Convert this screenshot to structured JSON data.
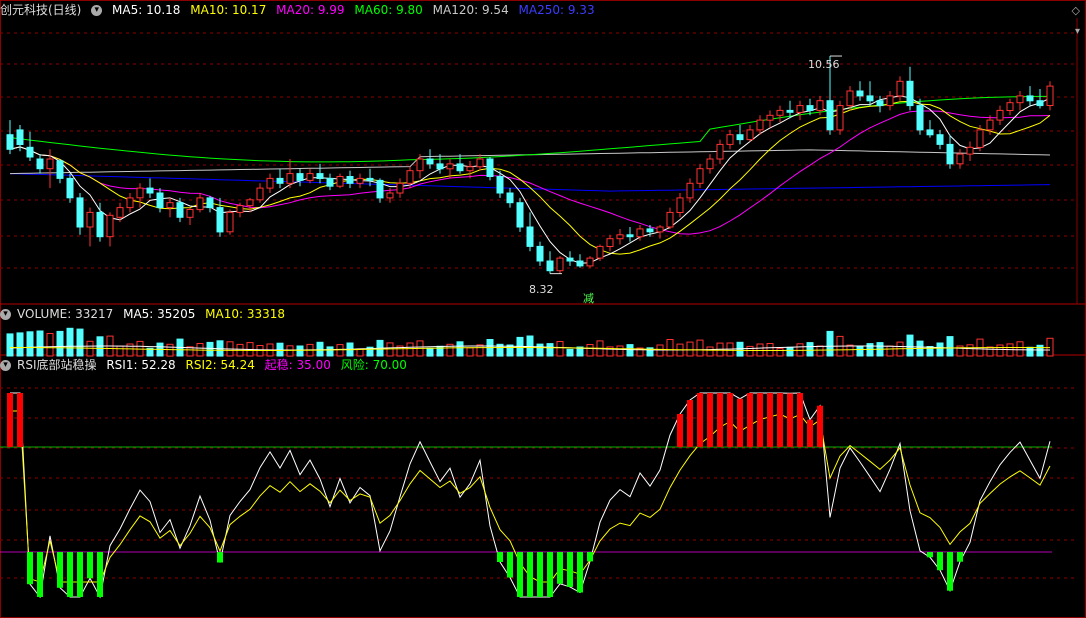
{
  "main_header": {
    "stock": "创元科技(日线)",
    "ma5": "MA5: 10.18",
    "ma10": "MA10: 10.17",
    "ma20": "MA20: 9.99",
    "ma60": "MA60: 9.80",
    "ma120": "MA120: 9.54",
    "ma250": "MA250: 9.33"
  },
  "volume_header": {
    "title": "VOLUME: 33217",
    "ma5": "MA5: 35205",
    "ma10": "MA10: 33318"
  },
  "rsi_header": {
    "title": "RSI底部站稳操",
    "rsi1": "RSI1: 52.28",
    "rsi2": "RSI2: 54.24",
    "qiwen": "起稳: 35.00",
    "fengxian": "风险: 70.00"
  },
  "annotations": {
    "high_label": "10.56",
    "low_label": "8.32",
    "jian_label": "减"
  },
  "colors": {
    "up": "#ff3232",
    "down": "#54ffff",
    "ma5": "#ffffff",
    "ma10": "#ffff00",
    "ma20": "#ff00ff",
    "ma60": "#00ff00",
    "ma120": "#c8c8c8",
    "ma250": "#0000ff",
    "grid": "#8b0000",
    "rsi_green_line": "#00b400",
    "rsi_magenta_line": "#b400b4"
  },
  "chart_data": [
    {
      "type": "candlestick",
      "title": "创元科技(日线)",
      "ylim": [
        8.1,
        10.9
      ],
      "annotated_high": 10.56,
      "annotated_low": 8.32,
      "ohlc": [
        [
          9.75,
          9.9,
          9.55,
          9.6
        ],
        [
          9.8,
          9.85,
          9.58,
          9.65
        ],
        [
          9.62,
          9.78,
          9.48,
          9.52
        ],
        [
          9.5,
          9.55,
          9.35,
          9.4
        ],
        [
          9.4,
          9.6,
          9.2,
          9.5
        ],
        [
          9.48,
          9.5,
          9.25,
          9.3
        ],
        [
          9.3,
          9.35,
          9.05,
          9.1
        ],
        [
          9.1,
          9.15,
          8.72,
          8.8
        ],
        [
          8.8,
          9.0,
          8.6,
          8.95
        ],
        [
          8.95,
          9.05,
          8.65,
          8.7
        ],
        [
          8.7,
          8.95,
          8.6,
          8.92
        ],
        [
          8.9,
          9.05,
          8.85,
          9.0
        ],
        [
          9.0,
          9.15,
          8.95,
          9.1
        ],
        [
          9.1,
          9.25,
          9.0,
          9.2
        ],
        [
          9.2,
          9.3,
          9.1,
          9.15
        ],
        [
          9.15,
          9.2,
          8.95,
          9.0
        ],
        [
          9.0,
          9.1,
          8.9,
          9.05
        ],
        [
          9.05,
          9.1,
          8.85,
          8.9
        ],
        [
          8.9,
          9.0,
          8.82,
          8.98
        ],
        [
          8.98,
          9.15,
          8.95,
          9.1
        ],
        [
          9.1,
          9.12,
          8.95,
          9.0
        ],
        [
          9.0,
          9.1,
          8.7,
          8.75
        ],
        [
          8.75,
          8.98,
          8.72,
          8.95
        ],
        [
          8.95,
          9.05,
          8.9,
          9.02
        ],
        [
          9.02,
          9.1,
          8.95,
          9.08
        ],
        [
          9.08,
          9.25,
          9.05,
          9.2
        ],
        [
          9.2,
          9.35,
          9.15,
          9.3
        ],
        [
          9.3,
          9.4,
          9.2,
          9.25
        ],
        [
          9.25,
          9.5,
          9.2,
          9.35
        ],
        [
          9.35,
          9.4,
          9.22,
          9.28
        ],
        [
          9.28,
          9.4,
          9.25,
          9.35
        ],
        [
          9.35,
          9.45,
          9.25,
          9.3
        ],
        [
          9.3,
          9.35,
          9.18,
          9.22
        ],
        [
          9.22,
          9.35,
          9.2,
          9.32
        ],
        [
          9.32,
          9.38,
          9.2,
          9.25
        ],
        [
          9.25,
          9.35,
          9.2,
          9.3
        ],
        [
          9.3,
          9.4,
          9.22,
          9.28
        ],
        [
          9.28,
          9.3,
          9.05,
          9.1
        ],
        [
          9.1,
          9.2,
          9.05,
          9.15
        ],
        [
          9.15,
          9.3,
          9.1,
          9.25
        ],
        [
          9.25,
          9.42,
          9.2,
          9.38
        ],
        [
          9.38,
          9.55,
          9.3,
          9.5
        ],
        [
          9.5,
          9.6,
          9.4,
          9.45
        ],
        [
          9.45,
          9.55,
          9.35,
          9.4
        ],
        [
          9.4,
          9.5,
          9.3,
          9.45
        ],
        [
          9.45,
          9.55,
          9.35,
          9.38
        ],
        [
          9.38,
          9.48,
          9.3,
          9.42
        ],
        [
          9.42,
          9.55,
          9.38,
          9.5
        ],
        [
          9.5,
          9.52,
          9.28,
          9.32
        ],
        [
          9.32,
          9.38,
          9.1,
          9.15
        ],
        [
          9.15,
          9.2,
          9.0,
          9.05
        ],
        [
          9.05,
          9.1,
          8.75,
          8.8
        ],
        [
          8.8,
          8.95,
          8.55,
          8.6
        ],
        [
          8.6,
          8.65,
          8.4,
          8.45
        ],
        [
          8.45,
          8.55,
          8.32,
          8.35
        ],
        [
          8.35,
          8.5,
          8.32,
          8.48
        ],
        [
          8.48,
          8.55,
          8.4,
          8.45
        ],
        [
          8.45,
          8.52,
          8.38,
          8.4
        ],
        [
          8.4,
          8.5,
          8.38,
          8.48
        ],
        [
          8.48,
          8.62,
          8.45,
          8.6
        ],
        [
          8.6,
          8.72,
          8.55,
          8.68
        ],
        [
          8.68,
          8.78,
          8.62,
          8.72
        ],
        [
          8.72,
          8.8,
          8.65,
          8.7
        ],
        [
          8.7,
          8.82,
          8.66,
          8.78
        ],
        [
          8.78,
          8.82,
          8.7,
          8.75
        ],
        [
          8.75,
          8.82,
          8.68,
          8.8
        ],
        [
          8.8,
          9.0,
          8.78,
          8.95
        ],
        [
          8.95,
          9.15,
          8.9,
          9.1
        ],
        [
          9.1,
          9.3,
          9.05,
          9.25
        ],
        [
          9.25,
          9.45,
          9.2,
          9.4
        ],
        [
          9.4,
          9.55,
          9.35,
          9.5
        ],
        [
          9.5,
          9.7,
          9.45,
          9.65
        ],
        [
          9.65,
          9.8,
          9.6,
          9.75
        ],
        [
          9.75,
          9.85,
          9.65,
          9.7
        ],
        [
          9.7,
          9.85,
          9.68,
          9.8
        ],
        [
          9.8,
          9.95,
          9.75,
          9.9
        ],
        [
          9.9,
          10.0,
          9.82,
          9.95
        ],
        [
          9.95,
          10.05,
          9.88,
          10.0
        ],
        [
          10.0,
          10.1,
          9.92,
          9.98
        ],
        [
          9.98,
          10.1,
          9.9,
          10.05
        ],
        [
          10.05,
          10.12,
          9.95,
          10.0
        ],
        [
          10.0,
          10.15,
          9.95,
          10.1
        ],
        [
          10.1,
          10.56,
          9.75,
          9.8
        ],
        [
          9.8,
          10.1,
          9.75,
          10.05
        ],
        [
          10.05,
          10.25,
          10.0,
          10.2
        ],
        [
          10.2,
          10.3,
          10.1,
          10.15
        ],
        [
          10.15,
          10.3,
          10.05,
          10.1
        ],
        [
          10.1,
          10.15,
          9.98,
          10.05
        ],
        [
          10.05,
          10.2,
          10.0,
          10.15
        ],
        [
          10.15,
          10.35,
          10.1,
          10.3
        ],
        [
          10.3,
          10.45,
          10.0,
          10.05
        ],
        [
          10.05,
          10.12,
          9.75,
          9.8
        ],
        [
          9.8,
          9.9,
          9.72,
          9.75
        ],
        [
          9.75,
          9.8,
          9.6,
          9.65
        ],
        [
          9.65,
          9.75,
          9.4,
          9.45
        ],
        [
          9.45,
          9.6,
          9.4,
          9.55
        ],
        [
          9.55,
          9.68,
          9.48,
          9.62
        ],
        [
          9.62,
          9.85,
          9.58,
          9.8
        ],
        [
          9.8,
          9.95,
          9.75,
          9.9
        ],
        [
          9.9,
          10.05,
          9.85,
          10.0
        ],
        [
          10.0,
          10.12,
          9.95,
          10.08
        ],
        [
          10.08,
          10.2,
          10.0,
          10.15
        ],
        [
          10.15,
          10.25,
          10.05,
          10.1
        ],
        [
          10.1,
          10.22,
          10.02,
          10.05
        ],
        [
          10.05,
          10.3,
          10.0,
          10.25
        ]
      ],
      "ma_values": {
        "ma5": 10.18,
        "ma10": 10.17,
        "ma20": 9.99,
        "ma60": 9.8,
        "ma120": 9.54,
        "ma250": 9.33
      }
    },
    {
      "type": "bar",
      "title": "VOLUME",
      "latest": 33217,
      "ma5": 35205,
      "ma10": 33318
    },
    {
      "type": "line",
      "title": "RSI底部站稳操",
      "ylim": [
        15,
        95
      ],
      "reference_lines": {
        "qiwen": 35,
        "fengxian": 70
      },
      "series": [
        {
          "name": "RSI1",
          "latest": 52.28
        },
        {
          "name": "RSI2",
          "latest": 54.24
        }
      ]
    }
  ]
}
